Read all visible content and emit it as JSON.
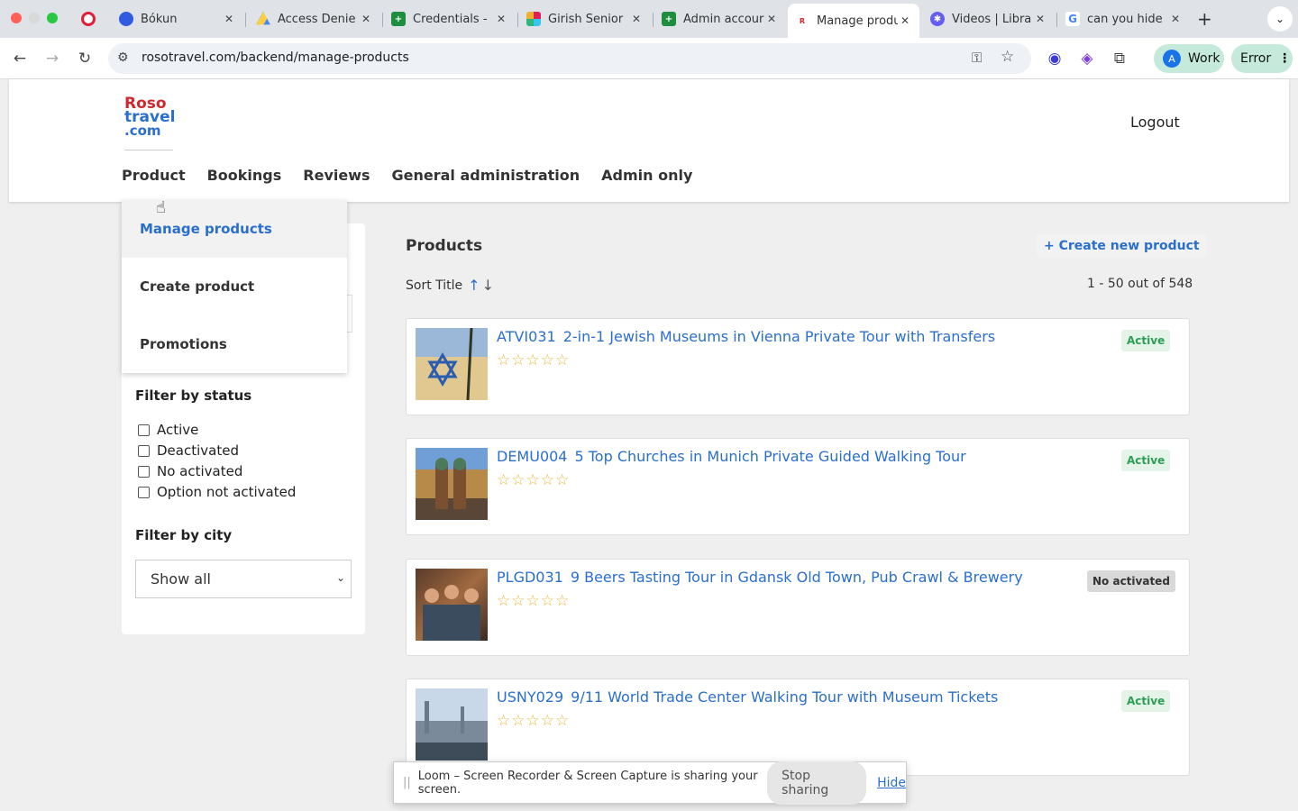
{
  "browser": {
    "tabs": [
      {
        "title": "",
        "favicon": "record-icon",
        "color": "#e01e37",
        "active": false
      },
      {
        "title": "Bókun",
        "favicon": "bokun-icon",
        "color": "#2f5be0",
        "active": false
      },
      {
        "title": "Access Denie",
        "favicon": "google-drive-icon",
        "color": "#1fa463",
        "active": false
      },
      {
        "title": "Credentials -",
        "favicon": "google-sheets-icon",
        "color": "#1e8e3e",
        "active": false
      },
      {
        "title": "Girish Senior",
        "favicon": "slack-icon",
        "color": "#e01e5a",
        "active": false
      },
      {
        "title": "Admin accour",
        "favicon": "google-sheets-icon",
        "color": "#1e8e3e",
        "active": false
      },
      {
        "title": "Manage produ",
        "favicon": "rosotravel-icon",
        "color": "#d0282e",
        "active": true
      },
      {
        "title": "Videos | Libra",
        "favicon": "loom-icon",
        "color": "#625df5",
        "active": false
      },
      {
        "title": "can you hide",
        "favicon": "google-icon",
        "color": "#4285f4",
        "active": false
      }
    ],
    "url": "rosotravel.com/backend/manage-products",
    "profile_initial": "A",
    "profile_label": "Work",
    "error_label": "Error"
  },
  "header": {
    "logo": {
      "line1": "Roso",
      "line2": "travel",
      "line3": ".com"
    },
    "logout": "Logout",
    "nav": [
      "Product",
      "Bookings",
      "Reviews",
      "General administration",
      "Admin only"
    ]
  },
  "dropdown": {
    "items": [
      "Manage products",
      "Create product",
      "Promotions"
    ],
    "selected_index": 0
  },
  "filters": {
    "status_title": "Filter by status",
    "statuses": [
      "Active",
      "Deactivated",
      "No activated",
      "Option not activated"
    ],
    "city_title": "Filter by city",
    "city_selected": "Show all"
  },
  "main": {
    "title": "Products",
    "create_label": "+ Create new product",
    "sort_label": "Sort Title",
    "count_label": "1 - 50 out of 548"
  },
  "products": [
    {
      "code": "ATVI031",
      "title": "2-in-1 Jewish Museums in Vienna Private Tour with Transfers",
      "status": "Active",
      "rating": 0
    },
    {
      "code": "DEMU004",
      "title": "5 Top Churches in Munich Private Guided Walking Tour",
      "status": "Active",
      "rating": 0
    },
    {
      "code": "PLGD031",
      "title": "9 Beers Tasting Tour in Gdansk Old Town, Pub Crawl & Brewery",
      "status": "No activated",
      "rating": 0
    },
    {
      "code": "USNY029",
      "title": "9/11 World Trade Center Walking Tour with Museum Tickets",
      "status": "Active",
      "rating": 0
    }
  ],
  "loom": {
    "message": "Loom – Screen Recorder & Screen Capture is sharing your screen.",
    "stop_label": "Stop sharing",
    "hide_label": "Hide"
  }
}
